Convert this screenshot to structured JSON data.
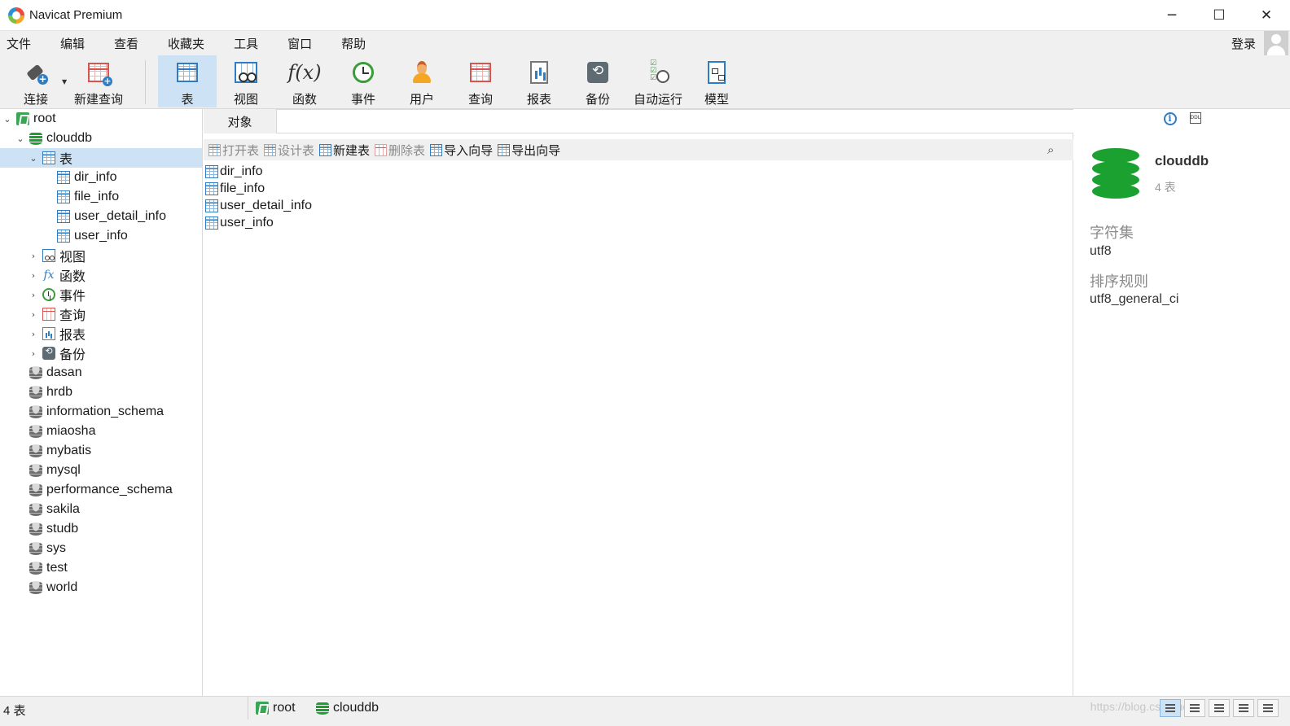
{
  "window": {
    "title": "Navicat Premium",
    "controls": [
      "─",
      "☐",
      "✕"
    ]
  },
  "menu": {
    "items": [
      "文件",
      "编辑",
      "查看",
      "收藏夹",
      "工具",
      "窗口",
      "帮助"
    ],
    "login": "登录"
  },
  "toolbar": {
    "connect": "连接",
    "new_query": "新建查询",
    "table": "表",
    "view": "视图",
    "function": "函数",
    "event": "事件",
    "user": "用户",
    "query": "查询",
    "report": "报表",
    "backup": "备份",
    "automation": "自动运行",
    "model": "模型"
  },
  "tree": {
    "connection": "root",
    "open_db": "clouddb",
    "tables_label": "表",
    "tables": [
      "dir_info",
      "file_info",
      "user_detail_info",
      "user_info"
    ],
    "groups": [
      "视图",
      "函数",
      "事件",
      "查询",
      "报表",
      "备份"
    ],
    "databases": [
      "dasan",
      "hrdb",
      "information_schema",
      "miaosha",
      "mybatis",
      "mysql",
      "performance_schema",
      "sakila",
      "studb",
      "sys",
      "test",
      "world"
    ]
  },
  "objects": {
    "tab": "对象",
    "actions": {
      "open_table": "打开表",
      "design_table": "设计表",
      "new_table": "新建表",
      "delete_table": "删除表",
      "import_wizard": "导入向导",
      "export_wizard": "导出向导"
    },
    "list": [
      "dir_info",
      "file_info",
      "user_detail_info",
      "user_info"
    ],
    "search_icon": "⌕"
  },
  "info": {
    "name": "clouddb",
    "count": "4 表",
    "charset_label": "字符集",
    "charset_value": "utf8",
    "collation_label": "排序规则",
    "collation_value": "utf8_general_ci"
  },
  "status": {
    "count": "4 表",
    "connection": "root",
    "database": "clouddb",
    "watermark": "https://blog.csdn.net"
  },
  "colors": {
    "selection": "#cde3f5",
    "db_green": "#1aa130",
    "table_blue": "#2e7cc4"
  }
}
